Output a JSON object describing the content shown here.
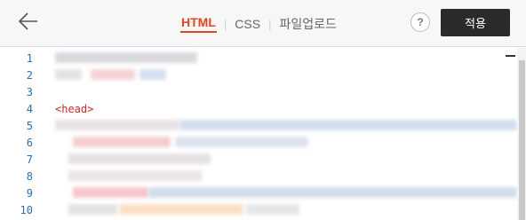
{
  "header": {
    "tabs": [
      {
        "label": "HTML",
        "active": true
      },
      {
        "label": "CSS",
        "active": false
      },
      {
        "label": "파일업로드",
        "active": false
      }
    ],
    "help_label": "?",
    "apply_label": "적용",
    "back_icon": "arrow-left-icon"
  },
  "editor": {
    "line_numbers": [
      "1",
      "2",
      "3",
      "4",
      "5",
      "6",
      "7",
      "8",
      "9",
      "10"
    ],
    "visible_code": {
      "line4": "<head>"
    }
  },
  "colors": {
    "accent": "#e0451f",
    "apply_bg": "#2b2b2b",
    "line_number": "#2a6fb0",
    "tag": "#c42a2a"
  }
}
